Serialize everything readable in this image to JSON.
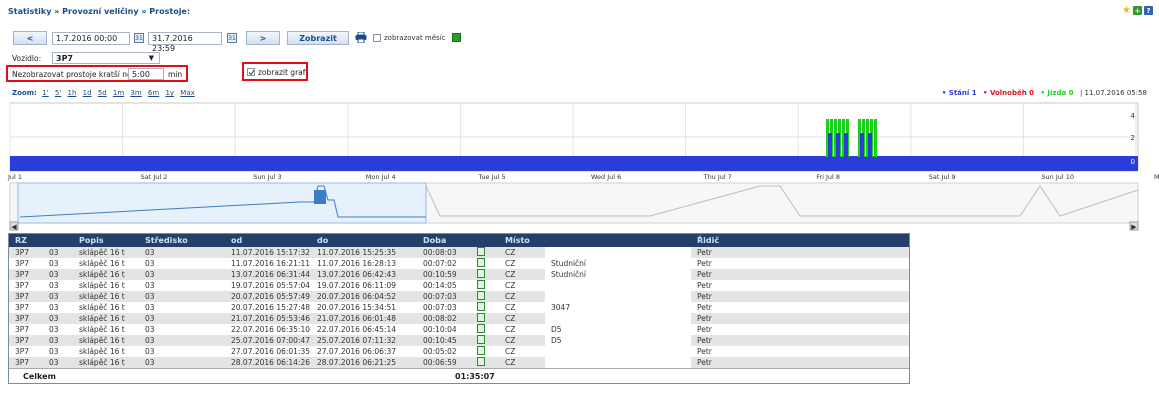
{
  "breadcrumb": "Statistiky » Provozní veličiny » Prostoje:",
  "filter": {
    "prev_label": "<",
    "next_label": ">",
    "date_from": "1.7.2016 00:00",
    "date_to": "31.7.2016 23:59",
    "calendar_label": "31",
    "show_label": "Zobrazit",
    "show_month_label": "zobrazovat měsíc",
    "vehicle_label": "Vozidlo:",
    "vehicle_value": "3P7",
    "min_label": "Nezobrazovat prostoje kratší než",
    "min_value": "5:00",
    "min_unit": "min",
    "show_graph_label": "zobrazit graf"
  },
  "chart": {
    "zoom_label": "Zoom:",
    "zoom_options": [
      "1'",
      "5'",
      "1h",
      "1d",
      "5d",
      "1m",
      "3m",
      "6m",
      "1y",
      "Max"
    ],
    "legend": {
      "stani": "• Stání 1",
      "volnobeh": "• Volnoběh 0",
      "jizda": "• Jízda 0",
      "date": "| 11.07.2016 05:58"
    },
    "colors": {
      "stani": "#2b3dd8",
      "volnobeh": "#e0101a",
      "jizda": "#1bd11b"
    },
    "y_ticks": [
      "4",
      "2",
      "0"
    ],
    "x_ticks": [
      "Jul 1",
      "Sat Jul 2",
      "Sun Jul 3",
      "Mon Jul 4",
      "Tue Jul 5",
      "Wed Jul 6",
      "Thu Jul 7",
      "Fri Jul 8",
      "Sat Jul 9",
      "Sun Jul 10",
      "Mon"
    ]
  },
  "chart_data": {
    "type": "area",
    "title": "",
    "x_range": [
      "2016-07-01",
      "2016-07-11"
    ],
    "ylim": [
      0,
      5
    ],
    "grid": true,
    "legend_placement": "top-right",
    "series": [
      {
        "name": "Stání",
        "values": [
          1
        ],
        "x": [
          "2016-07-01 to 2016-07-11"
        ]
      },
      {
        "name": "Jízda",
        "x": [
          "2016-07-08 08:00",
          "2016-07-08 17:30"
        ],
        "values": [
          4,
          4
        ]
      }
    ]
  },
  "table": {
    "headers": [
      "RZ",
      "Popis",
      "Středisko",
      "od",
      "do",
      "Doba",
      "",
      "Místo",
      "Řidič"
    ],
    "rows": [
      [
        "3P7",
        "03",
        "sklápěč 16 t",
        "03",
        "11.07.2016 15:17:32",
        "11.07.2016 15:25:35",
        "00:08:03",
        "CZ",
        "",
        "Petr"
      ],
      [
        "3P7",
        "03",
        "sklápěč 16 t",
        "03",
        "11.07.2016 16:21:11",
        "11.07.2016 16:28:13",
        "00:07:02",
        "CZ",
        "Studniční",
        "Petr"
      ],
      [
        "3P7",
        "03",
        "sklápěč 16 t",
        "03",
        "13.07.2016 06:31:44",
        "13.07.2016 06:42:43",
        "00:10:59",
        "CZ",
        "Studniční",
        "Petr"
      ],
      [
        "3P7",
        "03",
        "sklápěč 16 t",
        "03",
        "19.07.2016 05:57:04",
        "19.07.2016 06:11:09",
        "00:14:05",
        "CZ",
        "",
        "Petr"
      ],
      [
        "3P7",
        "03",
        "sklápěč 16 t",
        "03",
        "20.07.2016 05:57:49",
        "20.07.2016 06:04:52",
        "00:07:03",
        "CZ",
        "",
        "Petr"
      ],
      [
        "3P7",
        "03",
        "sklápěč 16 t",
        "03",
        "20.07.2016 15:27:48",
        "20.07.2016 15:34:51",
        "00:07:03",
        "CZ",
        "3047",
        "Petr"
      ],
      [
        "3P7",
        "03",
        "sklápěč 16 t",
        "03",
        "21.07.2016 05:53:46",
        "21.07.2016 06:01:48",
        "00:08:02",
        "CZ",
        "",
        "Petr"
      ],
      [
        "3P7",
        "03",
        "sklápěč 16 t",
        "03",
        "22.07.2016 06:35:10",
        "22.07.2016 06:45:14",
        "00:10:04",
        "CZ",
        "D5",
        "Petr"
      ],
      [
        "3P7",
        "03",
        "sklápěč 16 t",
        "03",
        "25.07.2016 07:00:47",
        "25.07.2016 07:11:32",
        "00:10:45",
        "CZ",
        "D5",
        "Petr"
      ],
      [
        "3P7",
        "03",
        "sklápěč 16 t",
        "03",
        "27.07.2016 06:01:35",
        "27.07.2016 06:06:37",
        "00:05:02",
        "CZ",
        "",
        "Petr"
      ],
      [
        "3P7",
        "03",
        "sklápěč 16 t",
        "03",
        "28.07.2016 06:14:26",
        "28.07.2016 06:21:25",
        "00:06:59",
        "CZ",
        "",
        "Petr"
      ]
    ],
    "total_label": "Celkem",
    "total_value": "01:35:07"
  }
}
